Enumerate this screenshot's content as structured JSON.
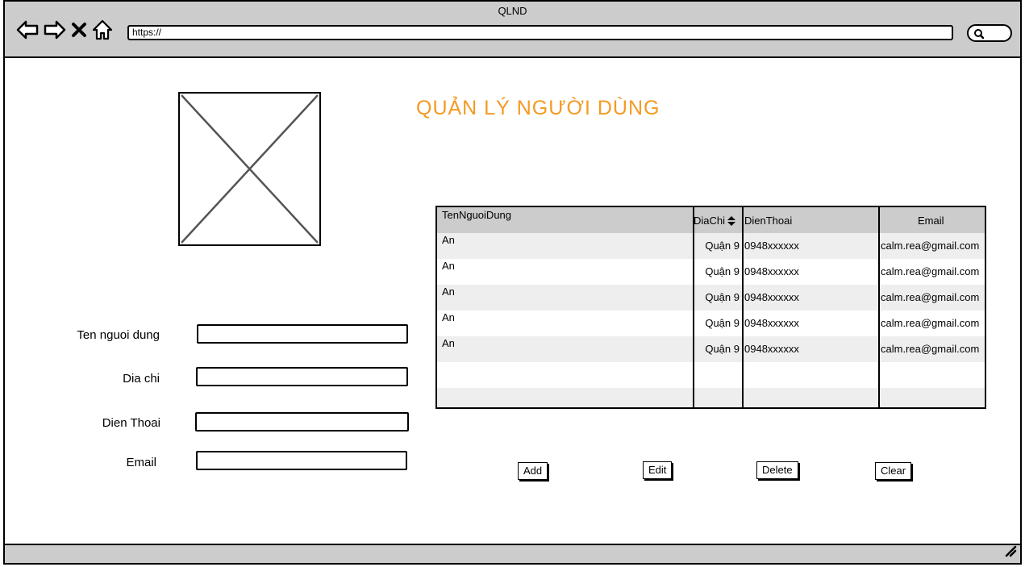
{
  "window": {
    "title": "QLND",
    "url": "https://"
  },
  "page": {
    "title": "QUẢN LÝ NGƯỜI DÙNG",
    "accent_color": "#f59a23"
  },
  "form": {
    "fields": [
      {
        "label": "Ten nguoi dung",
        "value": ""
      },
      {
        "label": "Dia chi",
        "value": ""
      },
      {
        "label": "Dien Thoai",
        "value": ""
      },
      {
        "label": "Email",
        "value": ""
      }
    ]
  },
  "table": {
    "columns": [
      "TenNguoiDung",
      "DiaChi",
      "DienThoai",
      "Email"
    ],
    "sort_icon": "sort-updown-icon",
    "rows": [
      [
        "An",
        "Quận 9",
        "0948xxxxxx",
        "calm.rea@gmail.com"
      ],
      [
        "An",
        "Quận 9",
        "0948xxxxxx",
        "calm.rea@gmail.com"
      ],
      [
        "An",
        "Quận 9",
        "0948xxxxxx",
        "calm.rea@gmail.com"
      ],
      [
        "An",
        "Quận 9",
        "0948xxxxxx",
        "calm.rea@gmail.com"
      ],
      [
        "An",
        "Quận 9",
        "0948xxxxxx",
        "calm.rea@gmail.com"
      ]
    ]
  },
  "buttons": {
    "add": "Add",
    "edit": "Edit",
    "delete": "Delete",
    "clear": "Clear"
  },
  "icons": [
    "back-arrow-icon",
    "forward-arrow-icon",
    "close-icon",
    "home-icon",
    "search-icon",
    "resize-grip-icon",
    "image-placeholder-icon"
  ]
}
